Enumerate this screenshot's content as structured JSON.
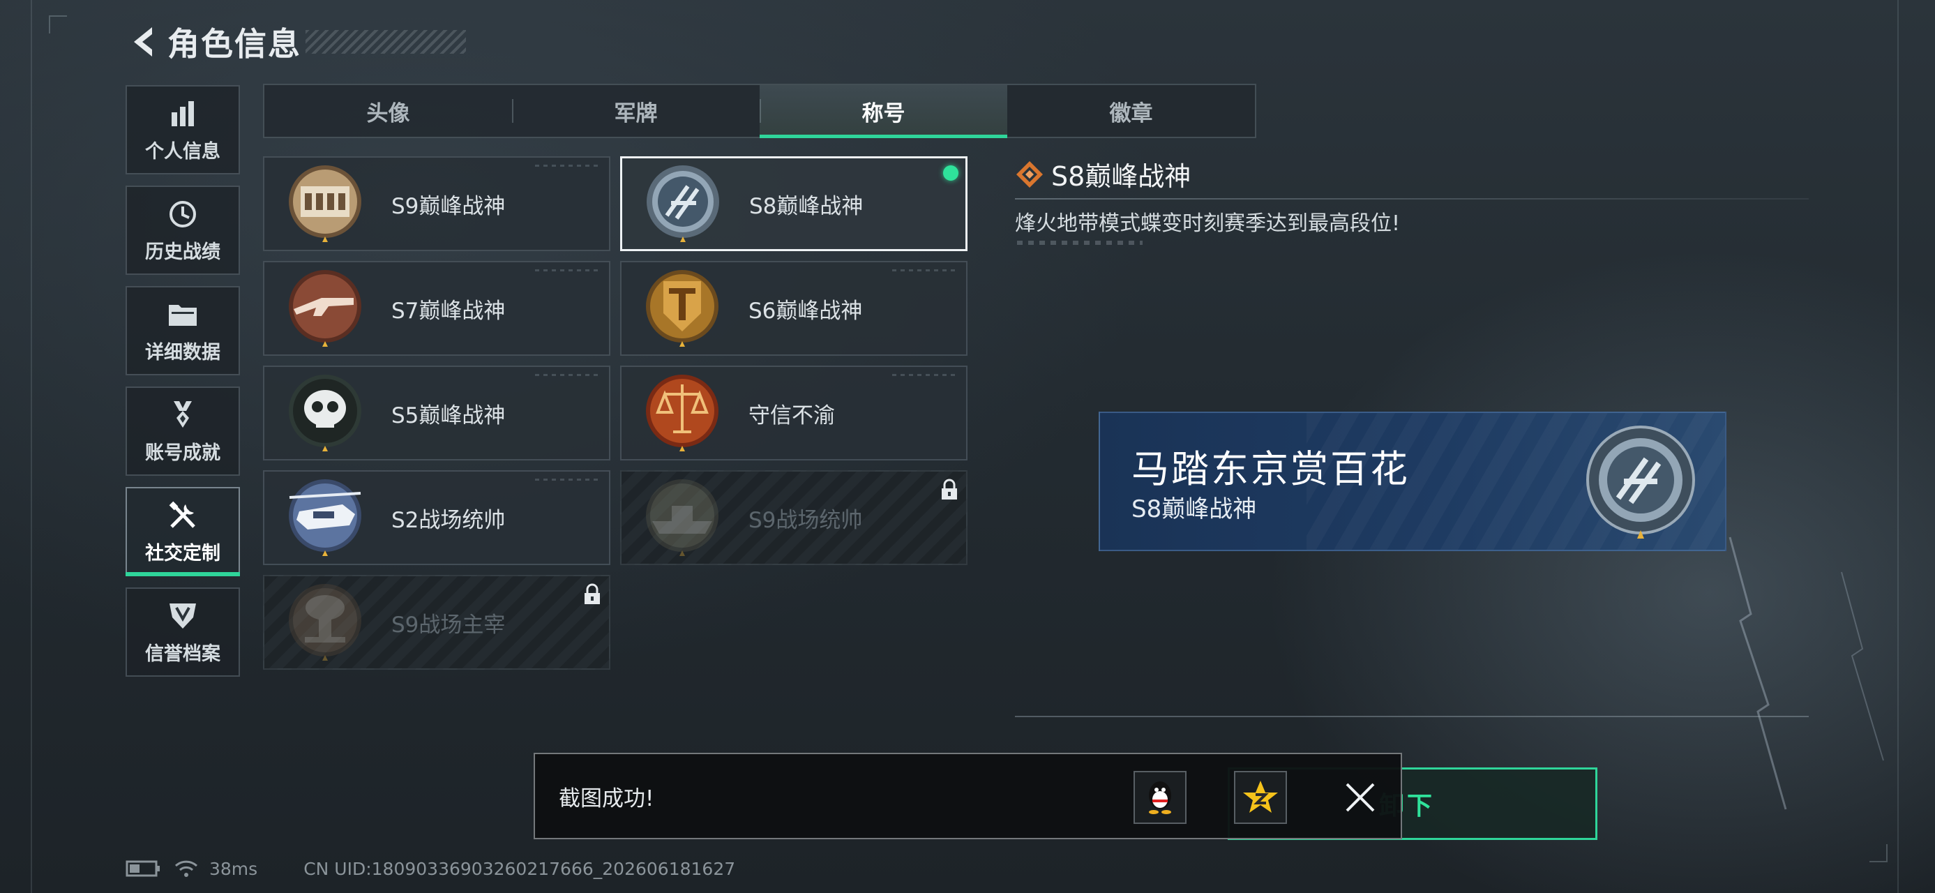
{
  "header": {
    "title": "角色信息"
  },
  "sidebar": {
    "items": [
      {
        "label": "个人信息",
        "icon": "bar-chart-icon"
      },
      {
        "label": "历史战绩",
        "icon": "clock-icon"
      },
      {
        "label": "详细数据",
        "icon": "folder-icon"
      },
      {
        "label": "账号成就",
        "icon": "medal-icon"
      },
      {
        "label": "社交定制",
        "icon": "tools-icon",
        "active": true
      },
      {
        "label": "信誉档案",
        "icon": "shield-icon"
      }
    ]
  },
  "tabs": [
    {
      "label": "头像"
    },
    {
      "label": "军牌"
    },
    {
      "label": "称号",
      "active": true
    },
    {
      "label": "徽章"
    }
  ],
  "titles": [
    {
      "label": "S9巅峰战神",
      "emblem": "building-emblem"
    },
    {
      "label": "S8巅峰战神",
      "emblem": "slash-disc-emblem",
      "selected": true,
      "equipped": true
    },
    {
      "label": "S7巅峰战神",
      "emblem": "rifle-emblem"
    },
    {
      "label": "S6巅峰战神",
      "emblem": "t-shield-emblem"
    },
    {
      "label": "S5巅峰战神",
      "emblem": "skull-mask-emblem"
    },
    {
      "label": "守信不渝",
      "emblem": "scales-emblem"
    },
    {
      "label": "S2战场统帅",
      "emblem": "helicopter-emblem"
    },
    {
      "label": "S9战场统帅",
      "emblem": "warship-emblem",
      "locked": true
    },
    {
      "label": "S9战场主宰",
      "emblem": "mushroom-cloud-emblem",
      "locked": true
    }
  ],
  "detail": {
    "title": "S8巅峰战神",
    "description": "烽火地带模式蝶变时刻赛季达到最高段位!"
  },
  "preview": {
    "player_name": "马踏东京赏百花",
    "title": "S8巅峰战神"
  },
  "unequip_button": {
    "label_partial": "卸下"
  },
  "toast": {
    "message": "截图成功!",
    "share_targets": [
      "qq-icon",
      "qzone-icon"
    ]
  },
  "status_bar": {
    "latency": "38ms",
    "uid": "CN UID:1809033690326021766​6_202606181627"
  },
  "colors": {
    "accent": "#2fd59a",
    "banner": "#1e3b62",
    "equipped": "#2fe29b"
  }
}
